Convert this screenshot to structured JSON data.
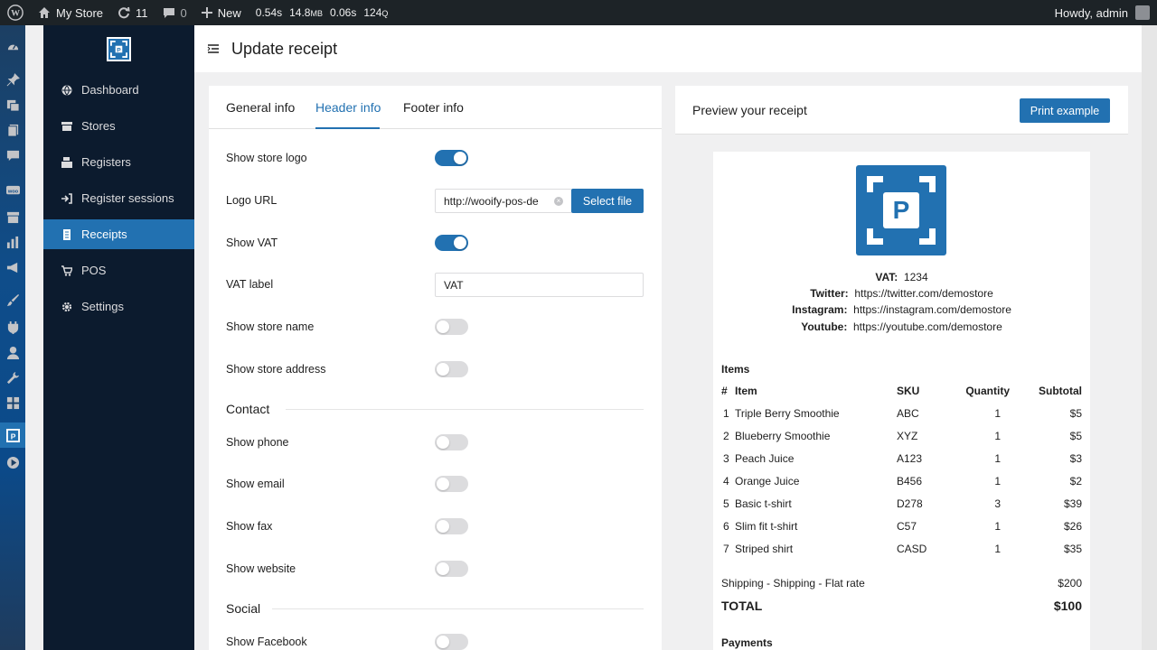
{
  "adminbar": {
    "site_name": "My Store",
    "updates_count": "11",
    "comments_count": "0",
    "new_label": "New",
    "stats": [
      "0.54s",
      "14.8",
      "MB",
      "0.06s",
      "124",
      "Q"
    ],
    "greeting": "Howdy, admin"
  },
  "sidebar": {
    "items": [
      {
        "label": "Dashboard",
        "icon": "globe-icon"
      },
      {
        "label": "Stores",
        "icon": "store-icon"
      },
      {
        "label": "Registers",
        "icon": "register-icon"
      },
      {
        "label": "Register sessions",
        "icon": "sign-in-icon"
      },
      {
        "label": "Receipts",
        "icon": "receipt-icon",
        "active": true
      },
      {
        "label": "POS",
        "icon": "cart-icon"
      },
      {
        "label": "Settings",
        "icon": "gear-icon"
      }
    ]
  },
  "page": {
    "title": "Update receipt"
  },
  "tabs": [
    "General info",
    "Header info",
    "Footer info"
  ],
  "active_tab": "Header info",
  "form": {
    "show_store_logo": {
      "label": "Show store logo",
      "on": true
    },
    "logo_url": {
      "label": "Logo URL",
      "value": "http://wooify-pos-de",
      "button": "Select file"
    },
    "show_vat": {
      "label": "Show VAT",
      "on": true
    },
    "vat_label": {
      "label": "VAT label",
      "value": "VAT"
    },
    "show_store_name": {
      "label": "Show store name",
      "on": false
    },
    "show_store_address": {
      "label": "Show store address",
      "on": false
    },
    "contact_title": "Contact",
    "show_phone": {
      "label": "Show phone",
      "on": false
    },
    "show_email": {
      "label": "Show email",
      "on": false
    },
    "show_fax": {
      "label": "Show fax",
      "on": false
    },
    "show_website": {
      "label": "Show website",
      "on": false
    },
    "social_title": "Social",
    "show_facebook": {
      "label": "Show Facebook",
      "on": false
    }
  },
  "preview": {
    "title": "Preview your receipt",
    "print_button": "Print example",
    "receipt": {
      "logo_letter": "P",
      "vat": {
        "label": "VAT:",
        "value": "1234"
      },
      "twitter": {
        "label": "Twitter:",
        "value": "https://twitter.com/demostore"
      },
      "instagram": {
        "label": "Instagram:",
        "value": "https://instagram.com/demostore"
      },
      "youtube": {
        "label": "Youtube:",
        "value": "https://youtube.com/demostore"
      },
      "items_heading": "Items",
      "columns": [
        "#",
        "Item",
        "SKU",
        "Quantity",
        "Subtotal"
      ],
      "items": [
        {
          "num": "1",
          "name": "Triple Berry Smoothie",
          "sku": "ABC",
          "qty": "1",
          "subtotal": "$5"
        },
        {
          "num": "2",
          "name": "Blueberry Smoothie",
          "sku": "XYZ",
          "qty": "1",
          "subtotal": "$5"
        },
        {
          "num": "3",
          "name": "Peach Juice",
          "sku": "A123",
          "qty": "1",
          "subtotal": "$3"
        },
        {
          "num": "4",
          "name": "Orange Juice",
          "sku": "B456",
          "qty": "1",
          "subtotal": "$2"
        },
        {
          "num": "5",
          "name": "Basic t-shirt",
          "sku": "D278",
          "qty": "3",
          "subtotal": "$39"
        },
        {
          "num": "6",
          "name": "Slim fit t-shirt",
          "sku": "C57",
          "qty": "1",
          "subtotal": "$26"
        },
        {
          "num": "7",
          "name": "Striped shirt",
          "sku": "CASD",
          "qty": "1",
          "subtotal": "$35"
        }
      ],
      "shipping_label": "Shipping - Shipping - Flat rate",
      "shipping_value": "$200",
      "total_label": "TOTAL",
      "total_value": "$100",
      "payments_heading": "Payments"
    }
  },
  "colors": {
    "accent": "#2271b1",
    "adminbar": "#1d2327",
    "sidebar": "#0c1b2e"
  }
}
